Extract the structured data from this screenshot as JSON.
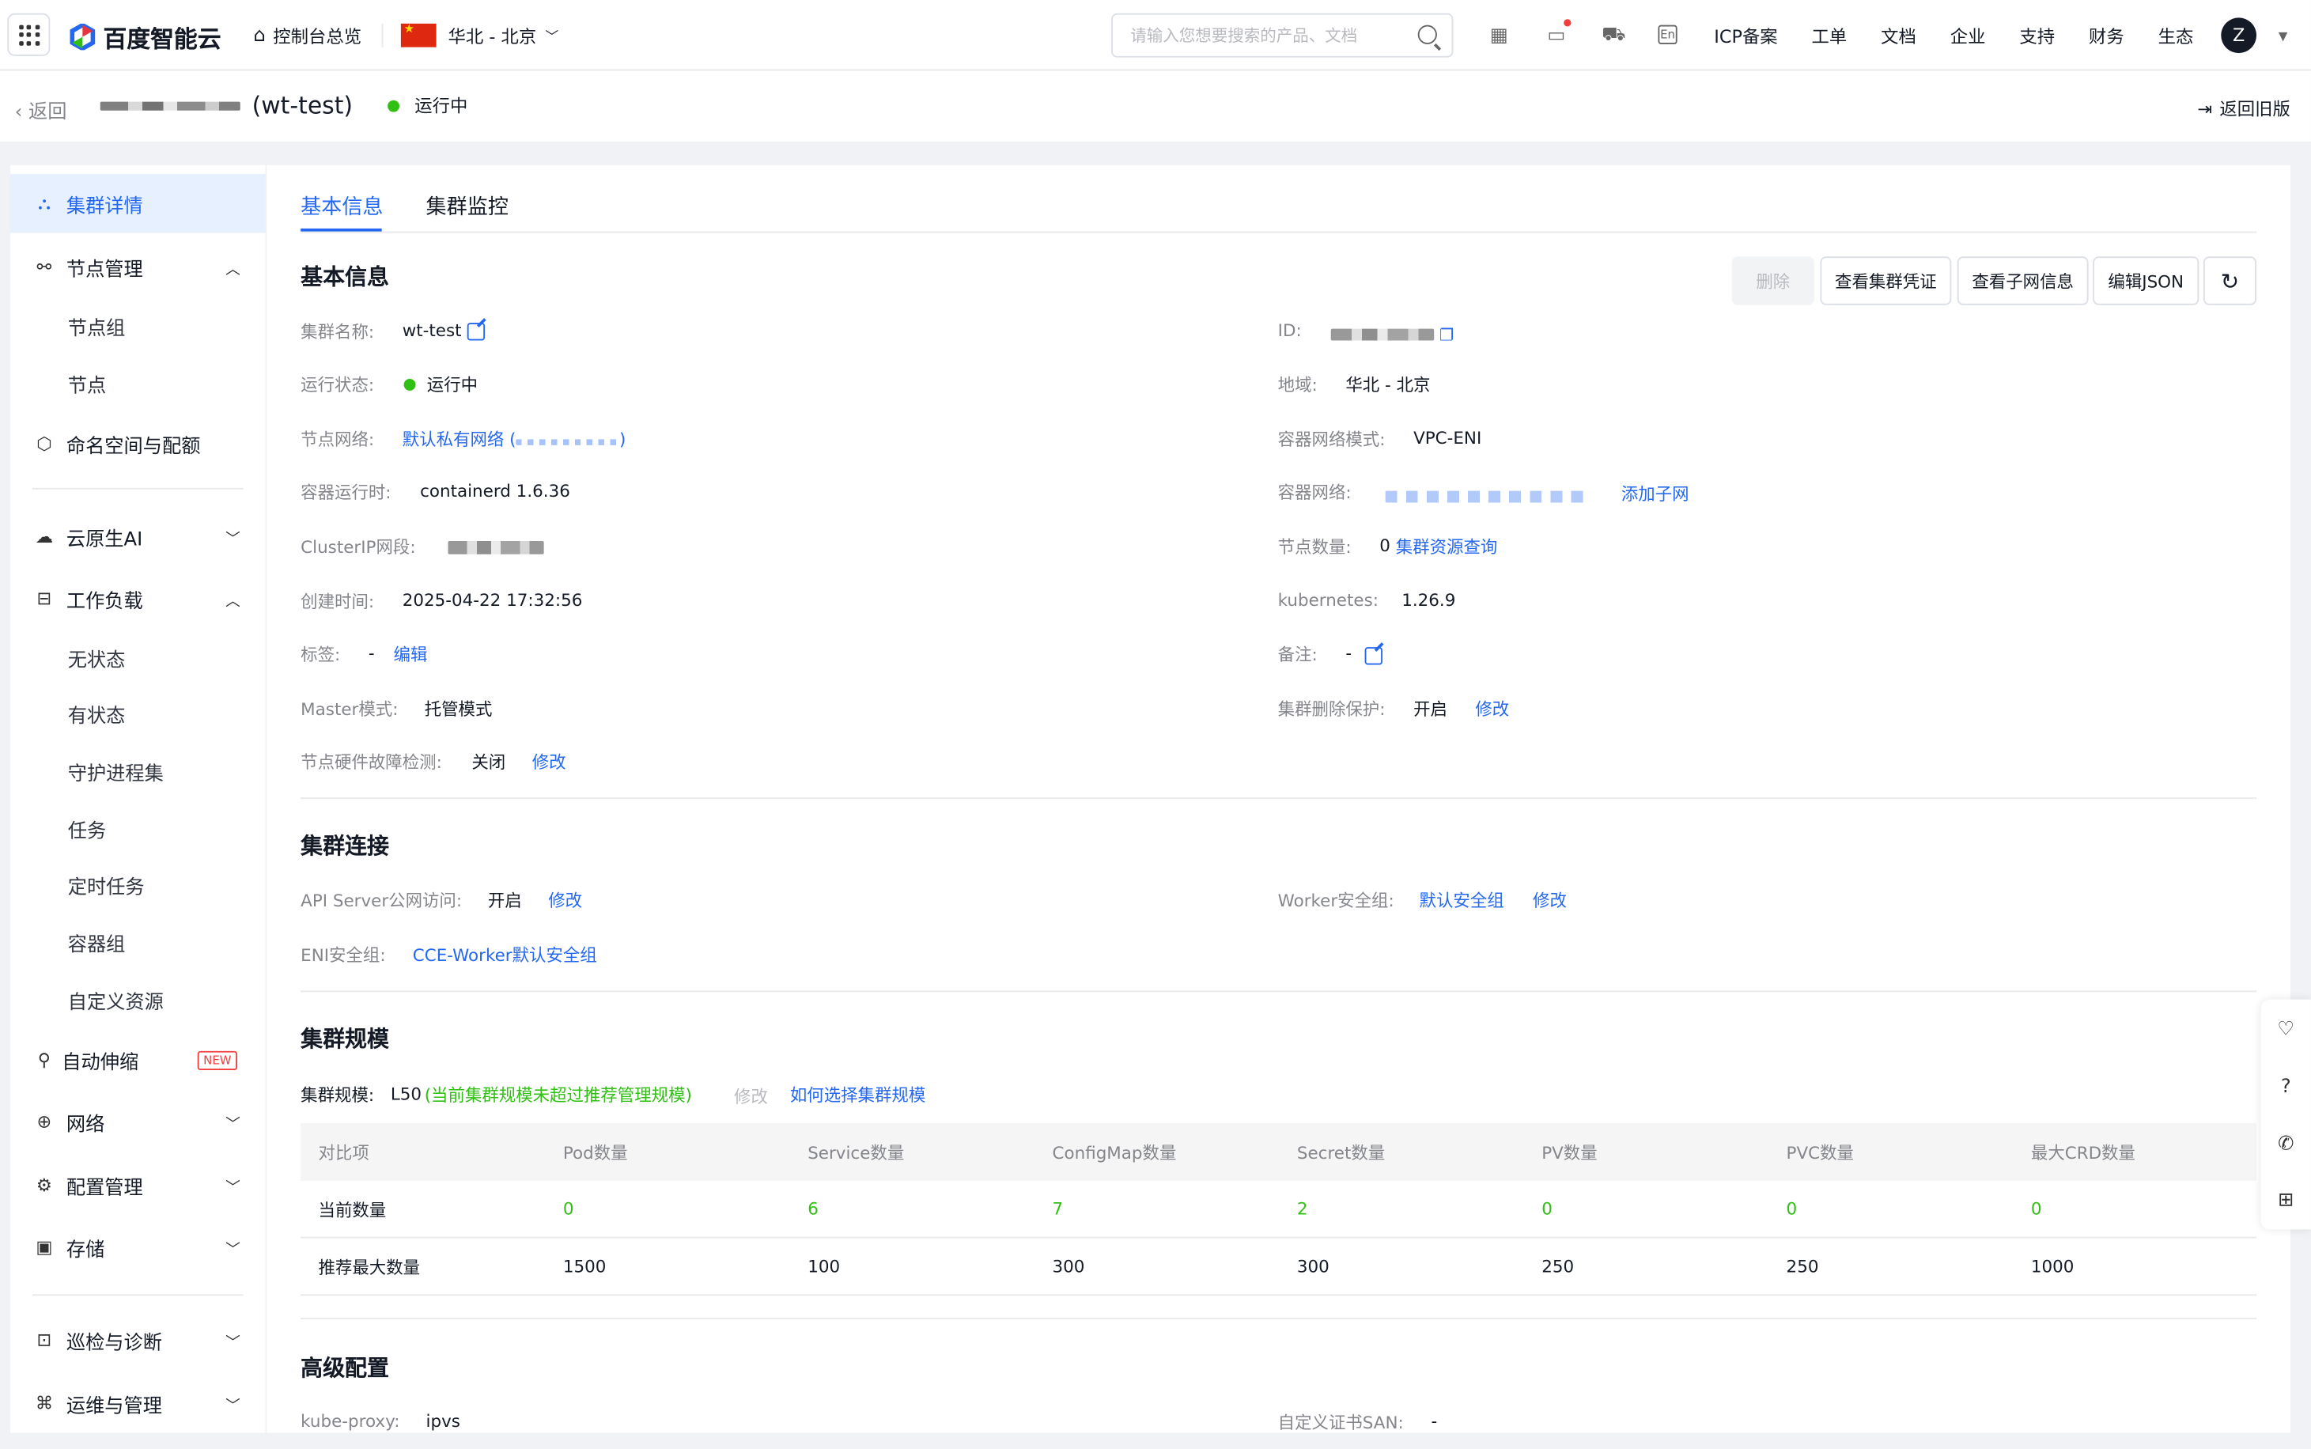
{
  "topbar": {
    "brand": "百度智能云",
    "console_home": "控制台总览",
    "region": "华北 - 北京",
    "search_placeholder": "请输入您想要搜索的产品、文档",
    "nav_links": [
      "ICP备案",
      "工单",
      "文档",
      "企业",
      "支持",
      "财务",
      "生态"
    ],
    "avatar_letter": "Z"
  },
  "subbar": {
    "back": "返回",
    "cluster_suffix": "(wt-test)",
    "status": "运行中",
    "old_version": "返回旧版"
  },
  "sidebar": {
    "cluster_detail": "集群详情",
    "node_mgmt": "节点管理",
    "node_group": "节点组",
    "node": "节点",
    "namespace": "命名空间与配额",
    "cloud_ai": "云原生AI",
    "workload": "工作负载",
    "stateless": "无状态",
    "stateful": "有状态",
    "daemonset": "守护进程集",
    "job": "任务",
    "cronjob": "定时任务",
    "pod": "容器组",
    "crd": "自定义资源",
    "autoscale": "自动伸缩",
    "new_tag": "NEW",
    "network": "网络",
    "config": "配置管理",
    "storage": "存储",
    "inspect": "巡检与诊断",
    "ops": "运维与管理"
  },
  "tabs": [
    "基本信息",
    "集群监控"
  ],
  "basic": {
    "title": "基本信息",
    "buttons": {
      "delete": "删除",
      "credential": "查看集群凭证",
      "subnet": "查看子网信息",
      "edit_json": "编辑JSON"
    },
    "name_label": "集群名称:",
    "name_value": "wt-test",
    "id_label": "ID:",
    "state_label": "运行状态:",
    "state_value": "运行中",
    "region_label": "地域:",
    "region_value": "华北 - 北京",
    "node_net_label": "节点网络:",
    "node_net_value": "默认私有网络",
    "container_mode_label": "容器网络模式:",
    "container_mode_value": "VPC-ENI",
    "runtime_label": "容器运行时:",
    "runtime_value": "containerd 1.6.36",
    "container_net_label": "容器网络:",
    "add_subnet": "添加子网",
    "clusterip_label": "ClusterIP网段:",
    "node_count_label": "节点数量:",
    "node_count_value": "0",
    "resource_query": "集群资源查询",
    "created_label": "创建时间:",
    "created_value": "2025-04-22 17:32:56",
    "k8s_label": "kubernetes:",
    "k8s_value": "1.26.9",
    "tag_label": "标签:",
    "tag_value": "-",
    "tag_edit": "编辑",
    "remark_label": "备注:",
    "remark_value": "-",
    "master_label": "Master模式:",
    "master_value": "托管模式",
    "protect_label": "集群删除保护:",
    "protect_value": "开启",
    "protect_edit": "修改",
    "hw_label": "节点硬件故障检测:",
    "hw_value": "关闭",
    "hw_edit": "修改"
  },
  "connect": {
    "title": "集群连接",
    "api_label": "API Server公网访问:",
    "api_value": "开启",
    "api_edit": "修改",
    "worker_label": "Worker安全组:",
    "worker_value": "默认安全组",
    "worker_edit": "修改",
    "eni_label": "ENI安全组:",
    "eni_value": "CCE-Worker默认安全组"
  },
  "scale": {
    "title": "集群规模",
    "scale_label": "集群规模:",
    "scale_value": "L50",
    "scale_note": "(当前集群规模未超过推荐管理规模)",
    "scale_edit": "修改",
    "how_to": "如何选择集群规模",
    "table": {
      "headers": [
        "对比项",
        "Pod数量",
        "Service数量",
        "ConfigMap数量",
        "Secret数量",
        "PV数量",
        "PVC数量",
        "最大CRD数量"
      ],
      "rows": [
        [
          "当前数量",
          "0",
          "6",
          "7",
          "2",
          "0",
          "0",
          "0"
        ],
        [
          "推荐最大数量",
          "1500",
          "100",
          "300",
          "300",
          "250",
          "250",
          "1000"
        ]
      ]
    }
  },
  "advanced": {
    "title": "高级配置",
    "proxy_label": "kube-proxy:",
    "proxy_value": "ipvs",
    "san_label": "自定义证书SAN:",
    "san_value": "-"
  },
  "colors": {
    "accent": "#2468f2",
    "success": "#30bf13",
    "bg": "#f0f2f5"
  }
}
